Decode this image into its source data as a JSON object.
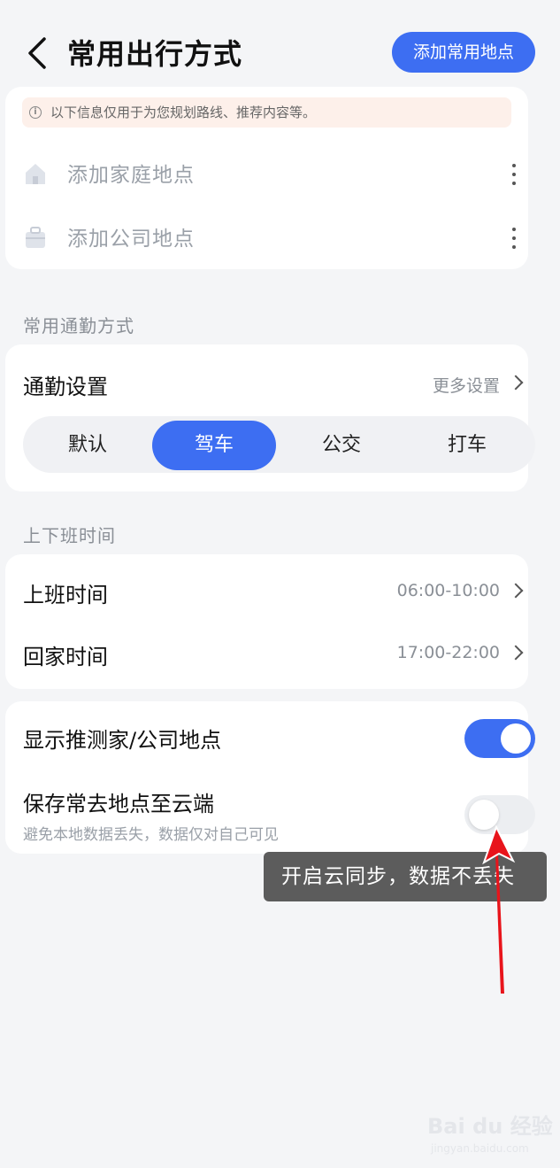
{
  "header": {
    "title": "常用出行方式",
    "add_button": "添加常用地点"
  },
  "places_card": {
    "notice": "以下信息仅用于为您规划路线、推荐内容等。",
    "items": [
      {
        "label": "添加家庭地点",
        "icon": "home-icon"
      },
      {
        "label": "添加公司地点",
        "icon": "briefcase-icon"
      }
    ]
  },
  "commute": {
    "section_label": "常用通勤方式",
    "settings_title": "通勤设置",
    "more_settings": "更多设置",
    "modes": [
      "默认",
      "驾车",
      "公交",
      "打车"
    ],
    "selected_mode": "驾车"
  },
  "work_hours": {
    "section_label": "上下班时间",
    "rows": [
      {
        "label": "上班时间",
        "value": "06:00-10:00"
      },
      {
        "label": "回家时间",
        "value": "17:00-22:00"
      }
    ]
  },
  "toggles": {
    "show_predicted": {
      "label": "显示推测家/公司地点",
      "on": true
    },
    "save_cloud": {
      "label": "保存常去地点至云端",
      "sub": "避免本地数据丢失，数据仅对自己可见",
      "on": false
    }
  },
  "annotation": {
    "tooltip": "开启云同步，数据不丢失"
  },
  "watermark": {
    "logo": "Bai du 经验",
    "url": "jingyan.baidu.com"
  },
  "colors": {
    "accent": "#3d6ef2",
    "background": "#f4f5f7",
    "arrow": "#e8141b"
  }
}
